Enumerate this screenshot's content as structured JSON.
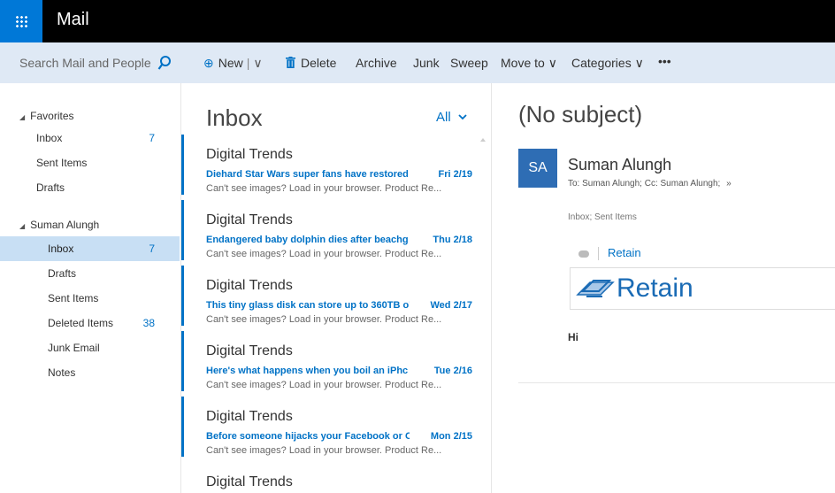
{
  "app": {
    "title": "Mail"
  },
  "search": {
    "placeholder": "Search Mail and People"
  },
  "toolbar": {
    "new_label": "New",
    "delete_label": "Delete",
    "archive_label": "Archive",
    "junk_label": "Junk",
    "sweep_label": "Sweep",
    "move_to_label": "Move to",
    "categories_label": "Categories",
    "more_label": "•••"
  },
  "nav": {
    "favorites_label": "Favorites",
    "favorites": [
      {
        "label": "Inbox",
        "count": "7"
      },
      {
        "label": "Sent Items",
        "count": ""
      },
      {
        "label": "Drafts",
        "count": ""
      }
    ],
    "account_label": "Suman Alungh",
    "folders": [
      {
        "label": "Inbox",
        "count": "7",
        "selected": true
      },
      {
        "label": "Drafts",
        "count": ""
      },
      {
        "label": "Sent Items",
        "count": ""
      },
      {
        "label": "Deleted Items",
        "count": "38"
      },
      {
        "label": "Junk Email",
        "count": ""
      },
      {
        "label": "Notes",
        "count": ""
      }
    ]
  },
  "list": {
    "title": "Inbox",
    "filter": "All",
    "messages": [
      {
        "sender": "Digital Trends",
        "subject": "Diehard Star Wars super fans have restored",
        "date": "Fri 2/19",
        "preview": "Can't see images? Load in your browser.  Product Re..."
      },
      {
        "sender": "Digital Trends",
        "subject": "Endangered baby dolphin dies after beachg",
        "date": "Thu 2/18",
        "preview": "Can't see images? Load in your browser.  Product Re..."
      },
      {
        "sender": "Digital Trends",
        "subject": "This tiny glass disk can store up to 360TB o'",
        "date": "Wed 2/17",
        "preview": "Can't see images? Load in your browser.  Product Re..."
      },
      {
        "sender": "Digital Trends",
        "subject": "Here's what happens when you boil an iPhc",
        "date": "Tue 2/16",
        "preview": "Can't see images? Load in your browser.  Product Re..."
      },
      {
        "sender": "Digital Trends",
        "subject": "Before someone hijacks your Facebook or C",
        "date": "Mon 2/15",
        "preview": "Can't see images? Load in your browser.  Product Re..."
      },
      {
        "sender": "Digital Trends",
        "subject": "",
        "date": "",
        "preview": ""
      }
    ]
  },
  "reading": {
    "subject": "(No subject)",
    "avatar_initials": "SA",
    "from": "Suman Alungh",
    "recipients": "To: Suman Alungh;  Cc: Suman Alungh;",
    "folders": "Inbox; Sent Items",
    "addin_label": "Retain",
    "logo_text": "Retain",
    "body": "Hi"
  },
  "colors": {
    "accent": "#0072c6",
    "topbar": "#000000",
    "waffle": "#0078d7",
    "cmdbar": "#dfe9f5",
    "selected": "#c8dff4"
  }
}
